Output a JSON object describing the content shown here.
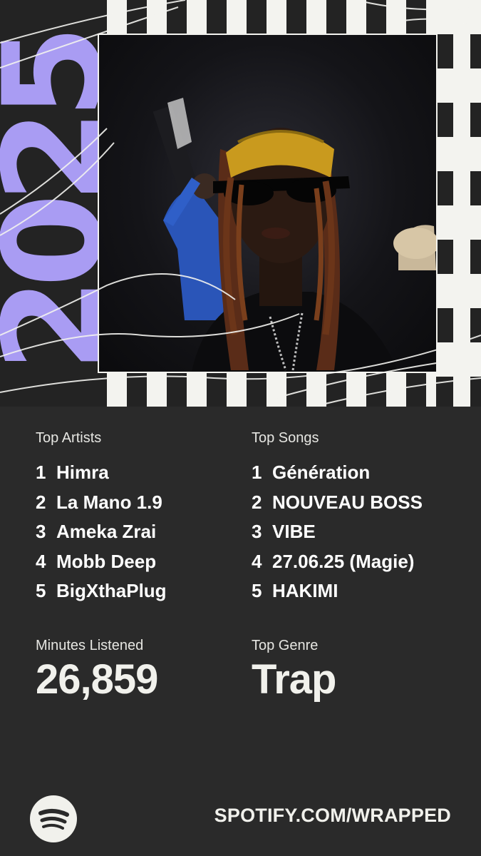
{
  "wrapped": {
    "year": "2025",
    "colors": {
      "accent": "#a99cf3",
      "background": "#2a2a2a",
      "cream": "#f3f3ef"
    }
  },
  "top_artists": {
    "label": "Top Artists",
    "items": [
      {
        "rank": "1",
        "name": "Himra"
      },
      {
        "rank": "2",
        "name": "La Mano 1.9"
      },
      {
        "rank": "3",
        "name": "Ameka Zrai"
      },
      {
        "rank": "4",
        "name": "Mobb Deep"
      },
      {
        "rank": "5",
        "name": "BigXthaPlug"
      }
    ]
  },
  "top_songs": {
    "label": "Top Songs",
    "items": [
      {
        "rank": "1",
        "name": "Génération"
      },
      {
        "rank": "2",
        "name": "NOUVEAU BOSS"
      },
      {
        "rank": "3",
        "name": "VIBE"
      },
      {
        "rank": "4",
        "name": "27.06.25 (Magie)"
      },
      {
        "rank": "5",
        "name": "HAKIMI"
      }
    ]
  },
  "minutes": {
    "label": "Minutes Listened",
    "value": "26,859"
  },
  "genre": {
    "label": "Top Genre",
    "value": "Trap"
  },
  "footer": {
    "url": "SPOTIFY.COM/WRAPPED",
    "logo_icon": "spotify-logo-icon"
  }
}
